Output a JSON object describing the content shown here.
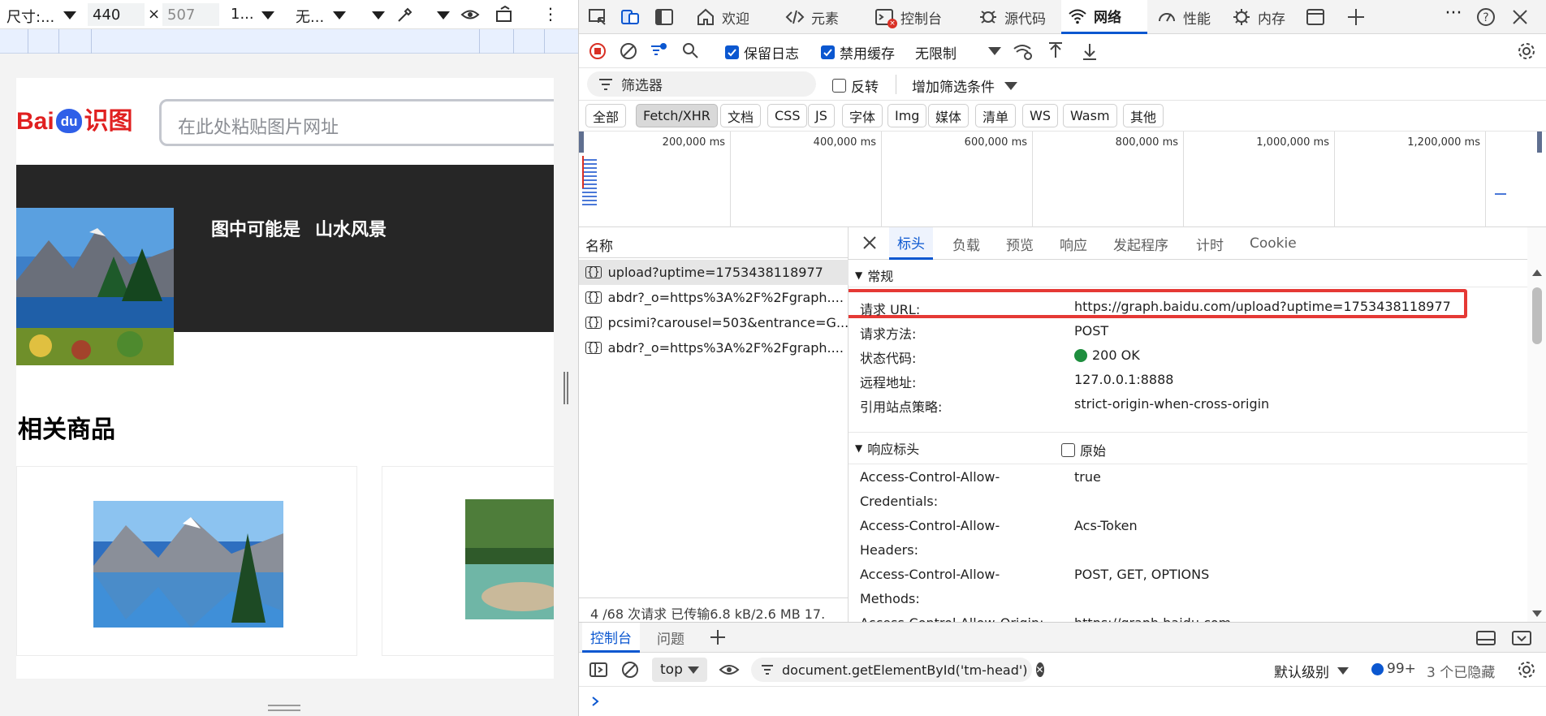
{
  "emulation": {
    "dimensions_label": "尺寸:...",
    "width": "440",
    "height": "507",
    "x_sep": "×",
    "zoom_label": "1...",
    "throttle_label": "无..."
  },
  "page": {
    "logo_left": "Bai",
    "logo_du": "du",
    "logo_right": "识图",
    "search_placeholder": "在此处粘贴图片网址",
    "result_prefix": "图中可能是",
    "result_label": "山水风景",
    "related_title": "相关商品"
  },
  "devtools": {
    "tabs": [
      {
        "label": "欢迎",
        "icon": "home-icon"
      },
      {
        "label": "元素",
        "icon": "code-icon"
      },
      {
        "label": "控制台",
        "icon": "console-icon"
      },
      {
        "label": "源代码",
        "icon": "bug-icon"
      },
      {
        "label": "网络",
        "icon": "wifi-icon"
      },
      {
        "label": "性能",
        "icon": "gauge-icon"
      },
      {
        "label": "内存",
        "icon": "chip-icon"
      }
    ],
    "active_tab": "网络",
    "toolbar": {
      "preserve_log": "保留日志",
      "disable_cache": "禁用缓存",
      "throttle": "无限制"
    },
    "filter": {
      "placeholder": "筛选器",
      "invert": "反转",
      "more_filters": "增加筛选条件"
    },
    "type_filters": [
      "全部",
      "Fetch/XHR",
      "文档",
      "CSS",
      "JS",
      "字体",
      "Img",
      "媒体",
      "清单",
      "WS",
      "Wasm",
      "其他"
    ],
    "active_type_filter": "Fetch/XHR",
    "timeline_labels": [
      "200,000 ms",
      "400,000 ms",
      "600,000 ms",
      "800,000 ms",
      "1,000,000 ms",
      "1,200,000 ms"
    ],
    "name_header": "名称",
    "requests": [
      "upload?uptime=1753438118977",
      "abdr?_o=https%3A%2F%2Fgraph....",
      "pcsimi?carousel=503&entrance=G...",
      "abdr?_o=https%3A%2F%2Fgraph...."
    ],
    "status_bar": "4 /68 次请求   已传输6.8 kB/2.6 MB   17.",
    "detail_tabs": [
      "标头",
      "负载",
      "预览",
      "响应",
      "发起程序",
      "计时",
      "Cookie"
    ],
    "active_detail_tab": "标头",
    "general_section": "常规",
    "general": [
      {
        "key": "请求 URL:",
        "value": "https://graph.baidu.com/upload?uptime=1753438118977"
      },
      {
        "key": "请求方法:",
        "value": "POST"
      },
      {
        "key": "状态代码:",
        "value": "200 OK"
      },
      {
        "key": "远程地址:",
        "value": "127.0.0.1:8888"
      },
      {
        "key": "引用站点策略:",
        "value": "strict-origin-when-cross-origin"
      }
    ],
    "response_section": "响应标头",
    "raw_label": "原始",
    "response_headers": [
      {
        "key1": "Access-Control-Allow-",
        "key2": "Credentials:",
        "value": "true"
      },
      {
        "key1": "Access-Control-Allow-",
        "key2": "Headers:",
        "value": "Acs-Token"
      },
      {
        "key1": "Access-Control-Allow-",
        "key2": "Methods:",
        "value": "POST, GET, OPTIONS"
      },
      {
        "key1": "Access-Control-Allow-Origin:",
        "key2": "",
        "value": "https://graph.baidu.com"
      }
    ],
    "drawer_tabs": [
      "控制台",
      "问题"
    ],
    "console": {
      "context": "top",
      "filter_value": "document.getElementById('tm-head')",
      "level": "默认级别",
      "issues_count": "99+",
      "hidden": "3 个已隐藏"
    },
    "colors": {
      "accent": "#0b57d0",
      "record_red": "#d93025",
      "status_ok": "#1e8e3e",
      "highlight": "#e53935"
    }
  }
}
